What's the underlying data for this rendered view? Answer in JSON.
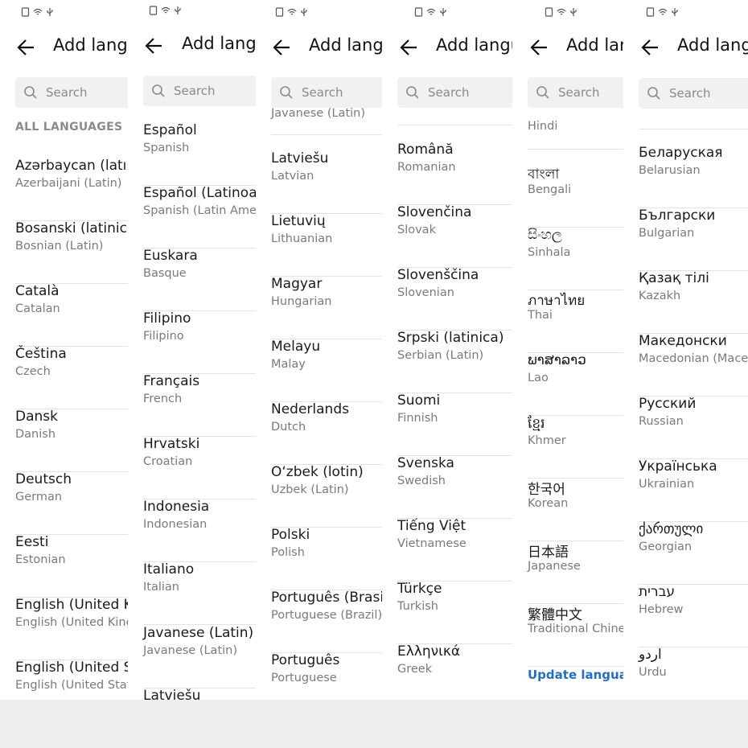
{
  "title": "Add language",
  "search_placeholder": "Search",
  "section_header": "ALL LANGUAGES",
  "update_label": "Update language",
  "colors": {
    "accent": "#1e6fc9",
    "background": "#ffffff",
    "gray_bg": "#efefef"
  },
  "panels": [
    {
      "items": [
        {
          "native": "Azərbaycan (latın)",
          "english": "Azerbaijani (Latin)"
        },
        {
          "native": "Bosanski (latinica)",
          "english": "Bosnian (Latin)"
        },
        {
          "native": "Català",
          "english": "Catalan"
        },
        {
          "native": "Čeština",
          "english": "Czech"
        },
        {
          "native": "Dansk",
          "english": "Danish"
        },
        {
          "native": "Deutsch",
          "english": "German"
        },
        {
          "native": "Eesti",
          "english": "Estonian"
        },
        {
          "native": "English (United Kingdom)",
          "english": "English (United Kingdom)"
        },
        {
          "native": "English (United States)",
          "english": "English (United States)"
        }
      ]
    },
    {
      "items": [
        {
          "native": "Español",
          "english": "Spanish"
        },
        {
          "native": "Español (Latinoamérica)",
          "english": "Spanish (Latin America)"
        },
        {
          "native": "Euskara",
          "english": "Basque"
        },
        {
          "native": "Filipino",
          "english": "Filipino"
        },
        {
          "native": "Français",
          "english": "French"
        },
        {
          "native": "Hrvatski",
          "english": "Croatian"
        },
        {
          "native": "Indonesia",
          "english": "Indonesian"
        },
        {
          "native": "Italiano",
          "english": "Italian"
        },
        {
          "native": "Javanese (Latin)",
          "english": "Javanese (Latin)"
        },
        {
          "native": "Latviešu",
          "english": ""
        }
      ]
    },
    {
      "items": [
        {
          "native": "",
          "english": "Javanese (Latin)"
        },
        {
          "native": "Latviešu",
          "english": "Latvian"
        },
        {
          "native": "Lietuvių",
          "english": "Lithuanian"
        },
        {
          "native": "Magyar",
          "english": "Hungarian"
        },
        {
          "native": "Melayu",
          "english": "Malay"
        },
        {
          "native": "Nederlands",
          "english": "Dutch"
        },
        {
          "native": "O‘zbek (lotin)",
          "english": "Uzbek (Latin)"
        },
        {
          "native": "Polski",
          "english": "Polish"
        },
        {
          "native": "Português (Brasil)",
          "english": "Portuguese (Brazil)"
        },
        {
          "native": "Português",
          "english": "Portuguese"
        }
      ]
    },
    {
      "items": [
        {
          "native": "Română",
          "english": "Romanian"
        },
        {
          "native": "Slovenčina",
          "english": "Slovak"
        },
        {
          "native": "Slovenščina",
          "english": "Slovenian"
        },
        {
          "native": "Srpski (latinica)",
          "english": "Serbian (Latin)"
        },
        {
          "native": "Suomi",
          "english": "Finnish"
        },
        {
          "native": "Svenska",
          "english": "Swedish"
        },
        {
          "native": "Tiếng Việt",
          "english": "Vietnamese"
        },
        {
          "native": "Türkçe",
          "english": "Turkish"
        },
        {
          "native": "Ελληνικά",
          "english": "Greek"
        }
      ]
    },
    {
      "items": [
        {
          "native": "",
          "english": "Hindi"
        },
        {
          "native": "বাংলা",
          "english": "Bengali"
        },
        {
          "native": "සිංහල",
          "english": "Sinhala"
        },
        {
          "native": "ภาษาไทย",
          "english": "Thai"
        },
        {
          "native": "ພາສາລາວ",
          "english": "Lao"
        },
        {
          "native": "ខ្មែរ",
          "english": "Khmer"
        },
        {
          "native": "한국어",
          "english": "Korean"
        },
        {
          "native": "日本語",
          "english": "Japanese"
        },
        {
          "native": "繁體中文",
          "english": "Traditional Chinese"
        }
      ]
    },
    {
      "items": [
        {
          "native": "Беларуская",
          "english": "Belarusian"
        },
        {
          "native": "Български",
          "english": "Bulgarian"
        },
        {
          "native": "Қазақ тілі",
          "english": "Kazakh"
        },
        {
          "native": "Македонски",
          "english": "Macedonian (Macedonia)"
        },
        {
          "native": "Русский",
          "english": "Russian"
        },
        {
          "native": "Українська",
          "english": "Ukrainian"
        },
        {
          "native": "ქართული",
          "english": "Georgian"
        },
        {
          "native": "עברית",
          "english": "Hebrew"
        },
        {
          "native": "اردو",
          "english": "Urdu"
        }
      ]
    }
  ]
}
